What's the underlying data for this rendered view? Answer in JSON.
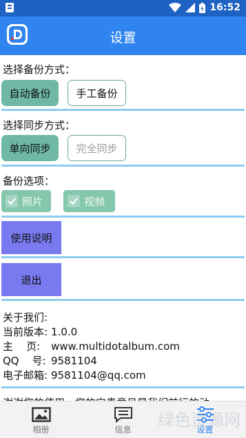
{
  "statusbar": {
    "time": "16:52"
  },
  "appbar": {
    "title": "设置"
  },
  "backup_mode": {
    "label": "选择备份方式：",
    "options": [
      "自动备份",
      "手工备份"
    ],
    "selected": "自动备份"
  },
  "sync_mode": {
    "label": "选择同步方式：",
    "options": [
      "单向同步",
      "完全同步"
    ],
    "selected": "单向同步"
  },
  "backup_options": {
    "label": "备份选项：",
    "items": [
      {
        "label": "照片",
        "checked": true
      },
      {
        "label": "视频",
        "checked": true
      }
    ]
  },
  "actions": {
    "instructions": "使用说明",
    "exit": "退出"
  },
  "about": {
    "title": "关于我们:",
    "rows": [
      {
        "key": "当前版本:",
        "value": "1.0.0"
      },
      {
        "key": "主    页:",
        "value": "www.multidotalbum.com"
      },
      {
        "key": "QQ    号:",
        "value": "9581104"
      },
      {
        "key": "电子邮箱:",
        "value": "9581104@qq.com"
      }
    ]
  },
  "footer_text": "谢谢您的使用，您的宝贵意见是我们前行的动",
  "bottom_nav": [
    {
      "label": "相册",
      "icon": "image-icon",
      "active": false
    },
    {
      "label": "信息",
      "icon": "message-icon",
      "active": false
    },
    {
      "label": "设置",
      "icon": "sliders-icon",
      "active": true
    }
  ],
  "watermark": "绿色资源网",
  "colors": {
    "appbar": "#2f84f0",
    "statusbar": "#1e62c4",
    "divider": "#8ccbf1",
    "selected": "#6fb8a4",
    "action": "#7a7af0"
  }
}
